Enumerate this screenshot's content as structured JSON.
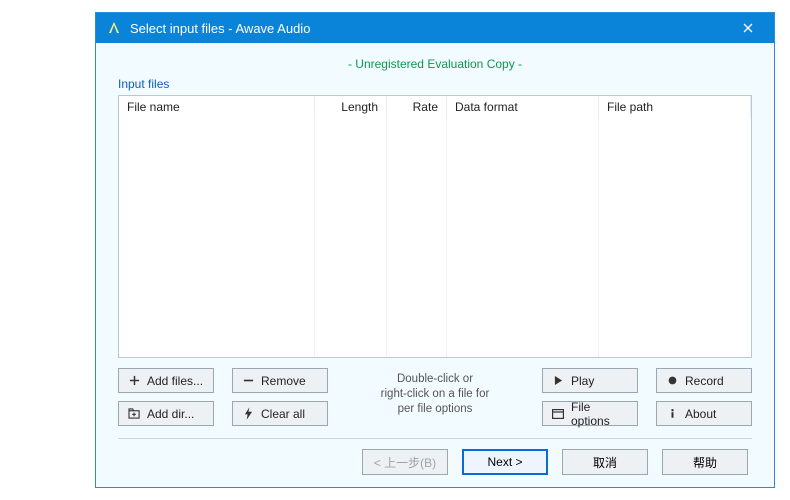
{
  "titlebar": {
    "title": "Select input files - Awave Audio"
  },
  "banner": {
    "eval_text": "- Unregistered Evaluation Copy -"
  },
  "group": {
    "label": "Input files"
  },
  "columns": {
    "name": "File name",
    "length": "Length",
    "rate": "Rate",
    "format": "Data format",
    "path": "File path"
  },
  "hint": {
    "line1": "Double-click or",
    "line2": "right-click on a file for",
    "line3": "per file options"
  },
  "buttons": {
    "add_files": "Add files...",
    "add_dir": "Add dir...",
    "remove": "Remove",
    "clear_all": "Clear all",
    "play": "Play",
    "record": "Record",
    "file_options": "File options",
    "about": "About"
  },
  "footer": {
    "back": "< 上一步(B)",
    "next": "Next  >",
    "cancel": "取消",
    "help": "帮助"
  }
}
